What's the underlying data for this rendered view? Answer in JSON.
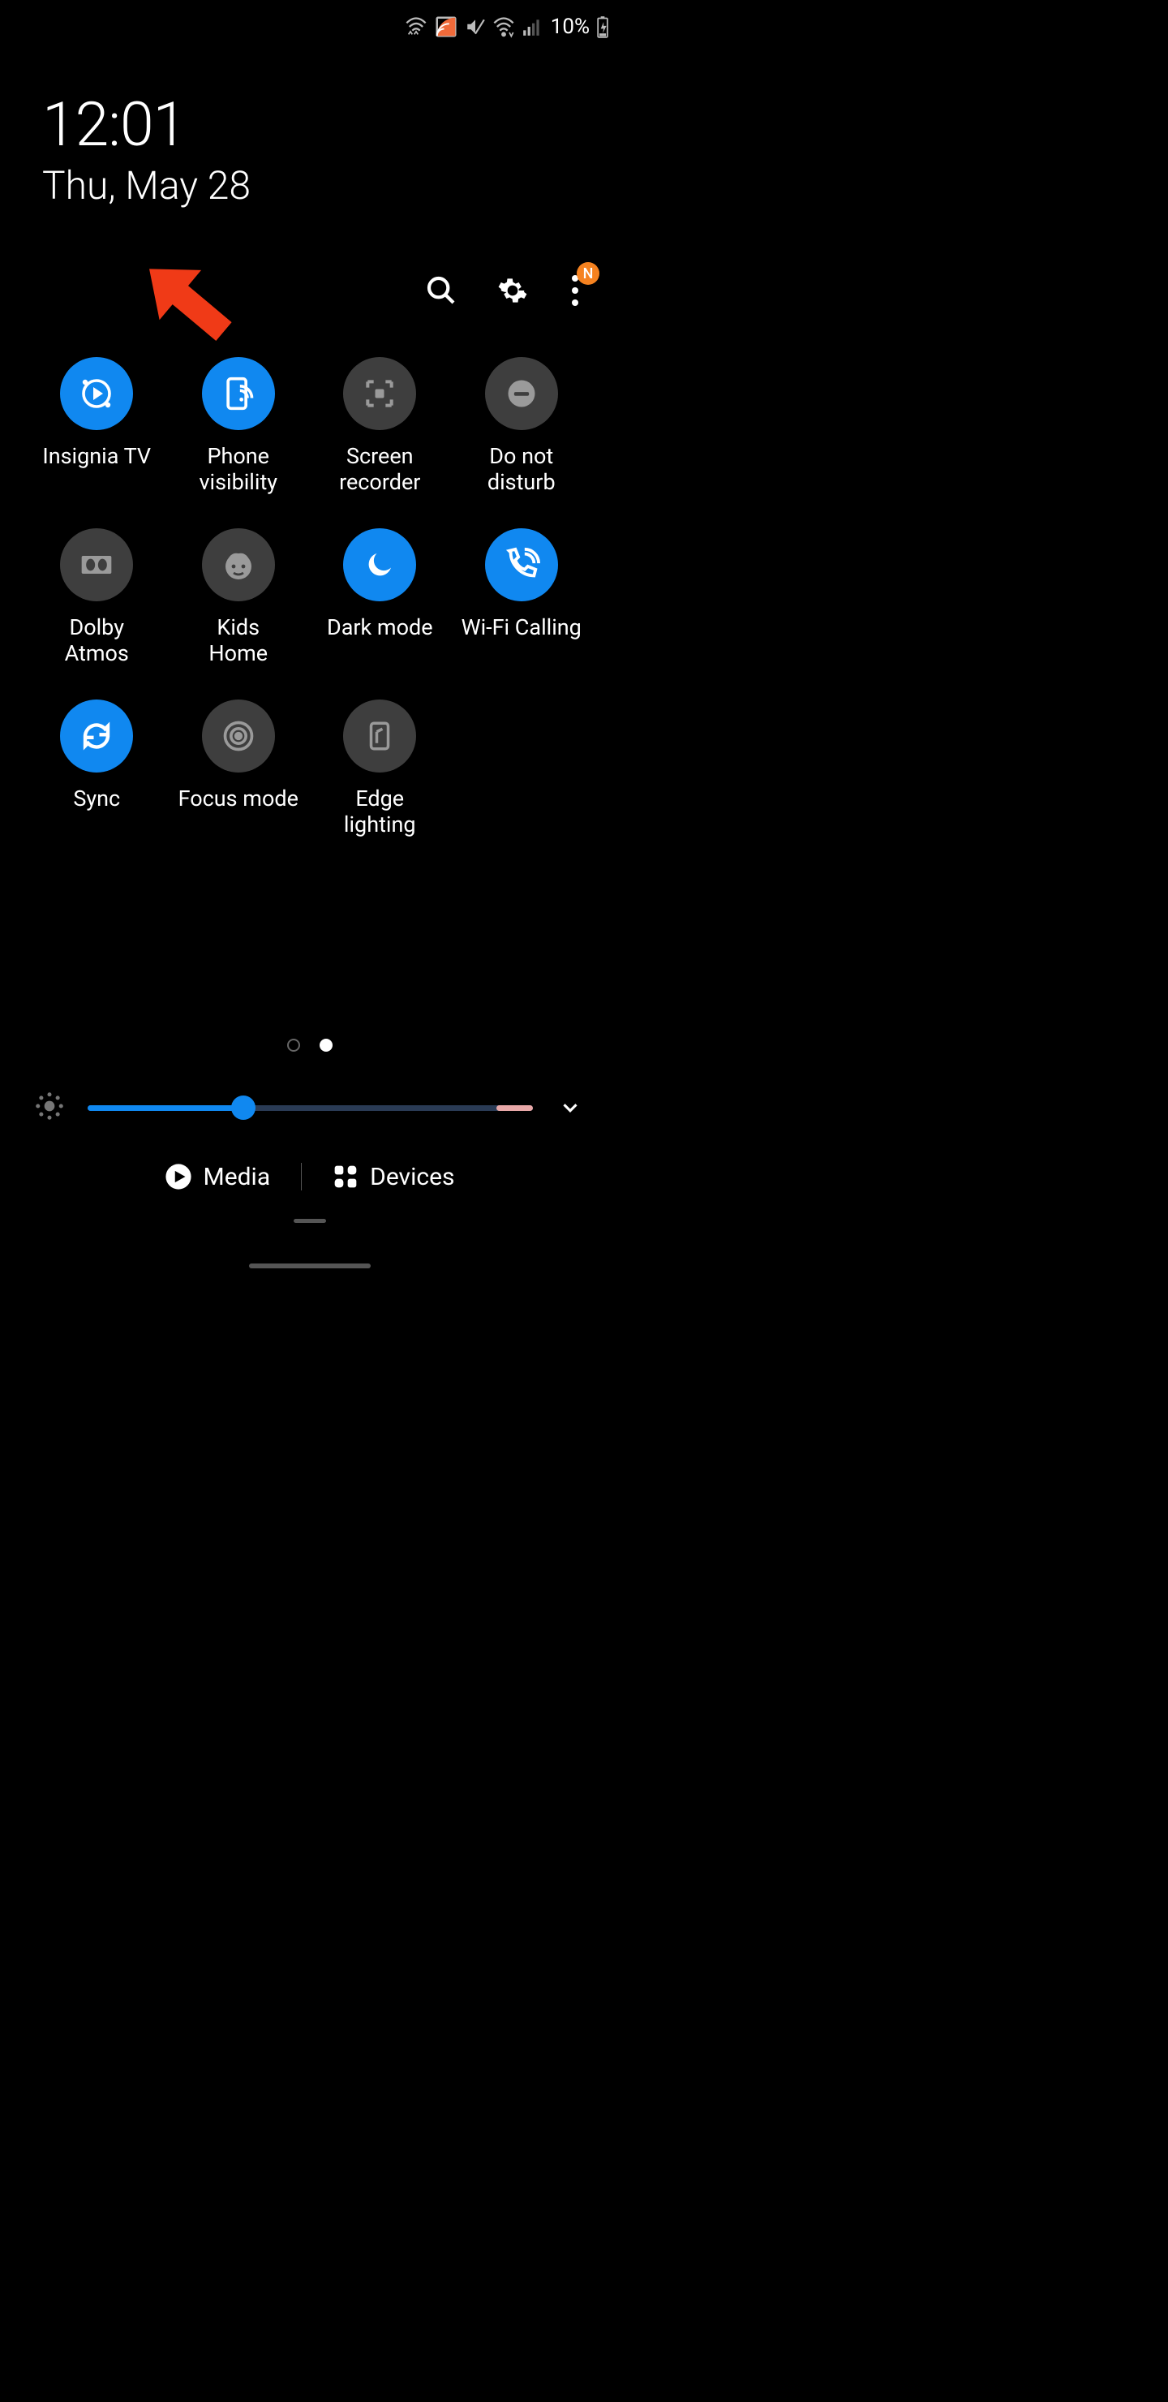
{
  "status": {
    "battery_text": "10%"
  },
  "header": {
    "time": "12:01",
    "date": "Thu, May 28"
  },
  "toolbar": {
    "more_badge": "N"
  },
  "tiles": [
    {
      "label": "Insignia TV",
      "active": true,
      "icon": "cast-play"
    },
    {
      "label": "Phone\nvisibility",
      "active": true,
      "icon": "phone-visibility"
    },
    {
      "label": "Screen\nrecorder",
      "active": false,
      "icon": "screen-recorder"
    },
    {
      "label": "Do not\ndisturb",
      "active": false,
      "icon": "do-not-disturb"
    },
    {
      "label": "Dolby\nAtmos",
      "active": false,
      "icon": "dolby"
    },
    {
      "label": "Kids\nHome",
      "active": false,
      "icon": "kid-face"
    },
    {
      "label": "Dark mode",
      "active": true,
      "icon": "moon"
    },
    {
      "label": "Wi-Fi Calling",
      "active": true,
      "icon": "wifi-calling"
    },
    {
      "label": "Sync",
      "active": true,
      "icon": "sync"
    },
    {
      "label": "Focus mode",
      "active": false,
      "icon": "target"
    },
    {
      "label": "Edge\nlighting",
      "active": false,
      "icon": "edge-lighting"
    }
  ],
  "pagination": {
    "pages": 2,
    "active": 1
  },
  "brightness": {
    "value_pct": 35
  },
  "bottom": {
    "media_label": "Media",
    "devices_label": "Devices"
  },
  "annotation": {
    "arrow_target": "Insignia TV",
    "arrow_color": "#f03a17"
  },
  "colors": {
    "accent": "#1088f0",
    "tile_off": "#3e3e3e",
    "badge": "#f58220"
  }
}
